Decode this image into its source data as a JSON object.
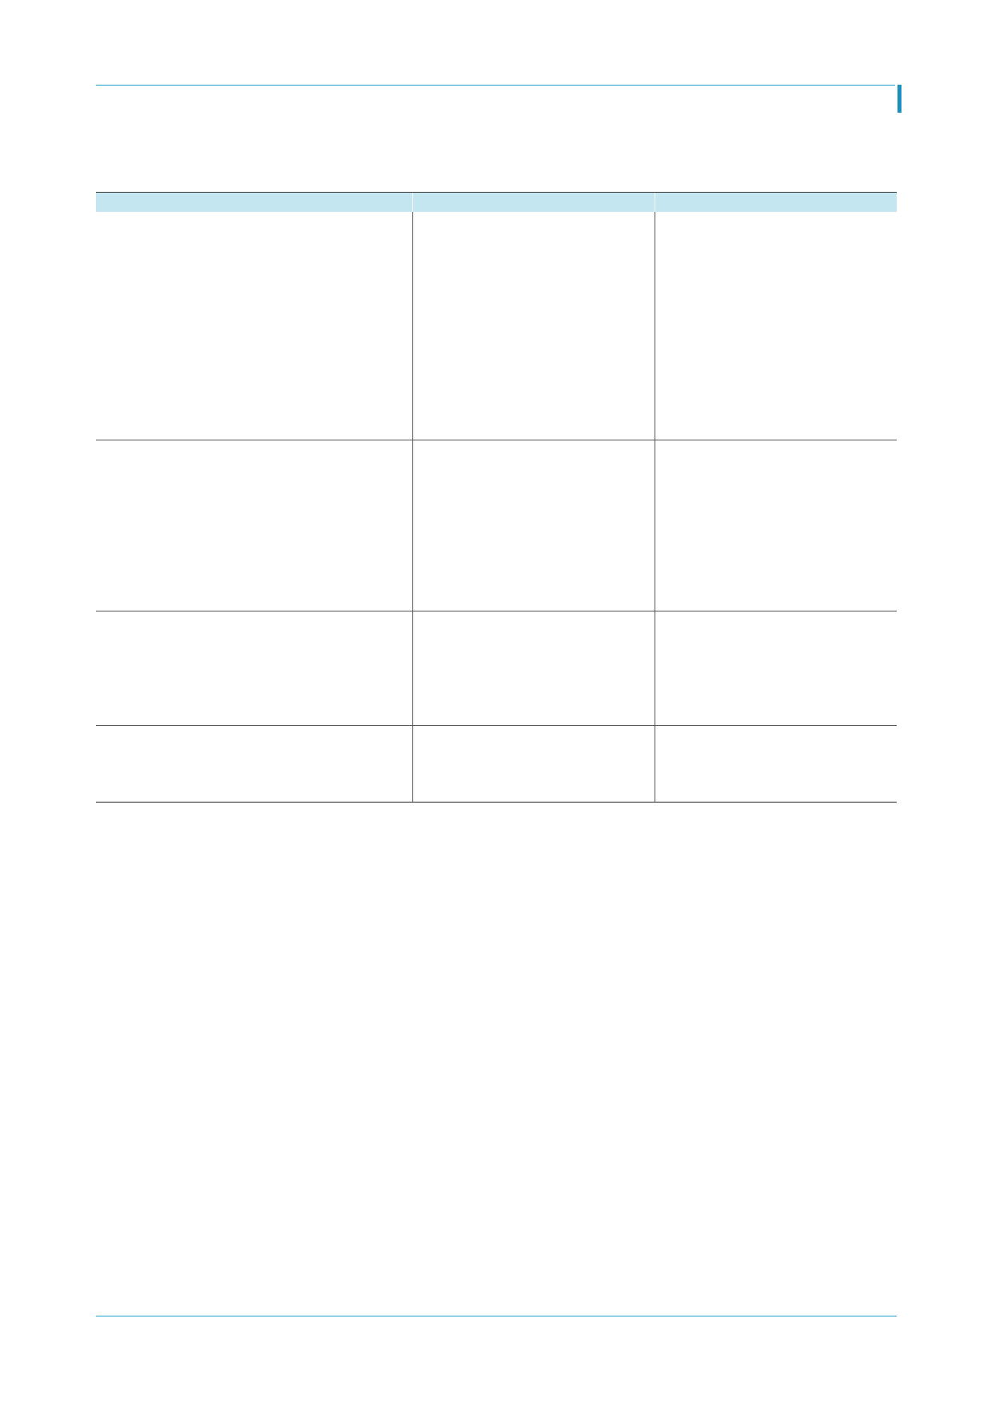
{
  "colors": {
    "accent": "#1a9fd0",
    "header_fill": "#c3e6f1",
    "rule": "#555555"
  },
  "table": {
    "headers": [
      "",
      "",
      ""
    ],
    "rows": [
      [
        "",
        "",
        ""
      ],
      [
        "",
        "",
        ""
      ],
      [
        "",
        "",
        ""
      ],
      [
        "",
        "",
        ""
      ]
    ]
  }
}
